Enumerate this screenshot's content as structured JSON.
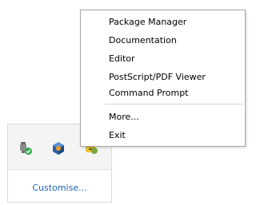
{
  "tray": {
    "icons": [
      {
        "name": "safely-remove-hardware-icon"
      },
      {
        "name": "virtualbox-icon"
      },
      {
        "name": "miktex-icon"
      }
    ],
    "customise_label": "Customise..."
  },
  "menu": {
    "items": [
      {
        "label": "Package Manager"
      },
      {
        "label": "Documentation"
      },
      {
        "label": "Editor"
      },
      {
        "label": "PostScript/PDF Viewer"
      },
      {
        "label": "Command Prompt"
      },
      {
        "label": "More..."
      },
      {
        "label": "Exit"
      }
    ]
  }
}
